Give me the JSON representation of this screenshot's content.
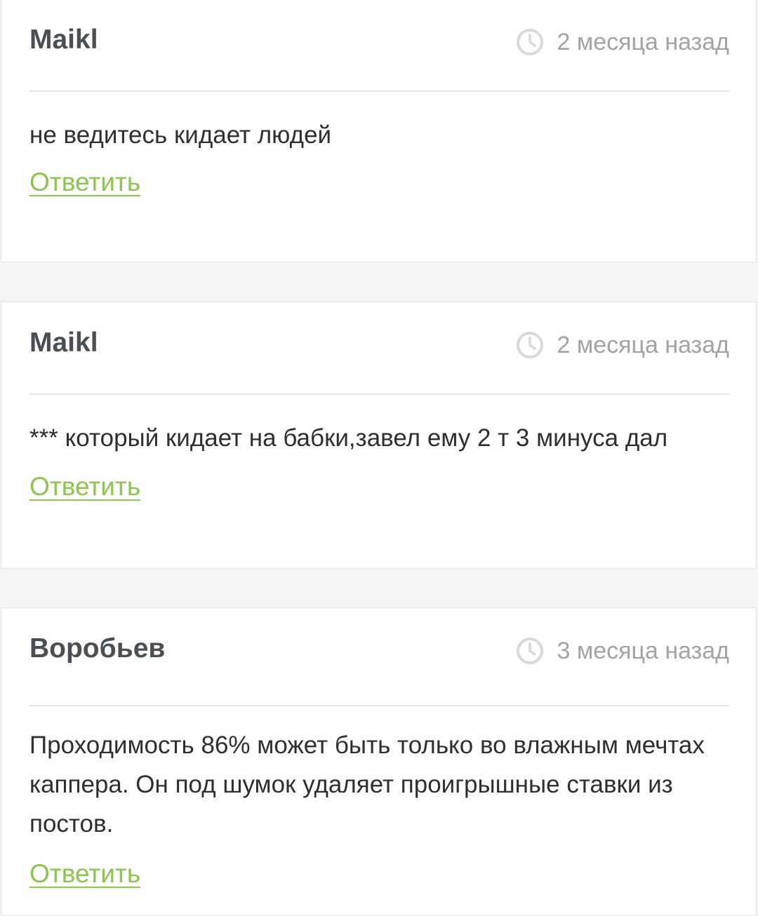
{
  "colors": {
    "accent_link": "#8ec450",
    "author": "#4a4f55",
    "date": "#a3a3a3",
    "background": "#f5f5f5"
  },
  "comments": [
    {
      "author": "Maikl",
      "date": "2 месяца назад",
      "text": "не ведитесь кидает людей",
      "reply_label": "Ответить",
      "icon": "clock-icon"
    },
    {
      "author": "Maikl",
      "date": "2 месяца назад",
      "text": "*** который кидает на бабки,завел ему 2 т 3 минуса дал",
      "reply_label": "Ответить",
      "icon": "clock-icon"
    },
    {
      "author": "Воробьев",
      "date": "3 месяца назад",
      "text": "Проходимость 86% может быть только во влажным мечтах каппера. Он под шумок удаляет проигрышные ставки из постов.",
      "reply_label": "Ответить",
      "icon": "clock-icon"
    }
  ]
}
